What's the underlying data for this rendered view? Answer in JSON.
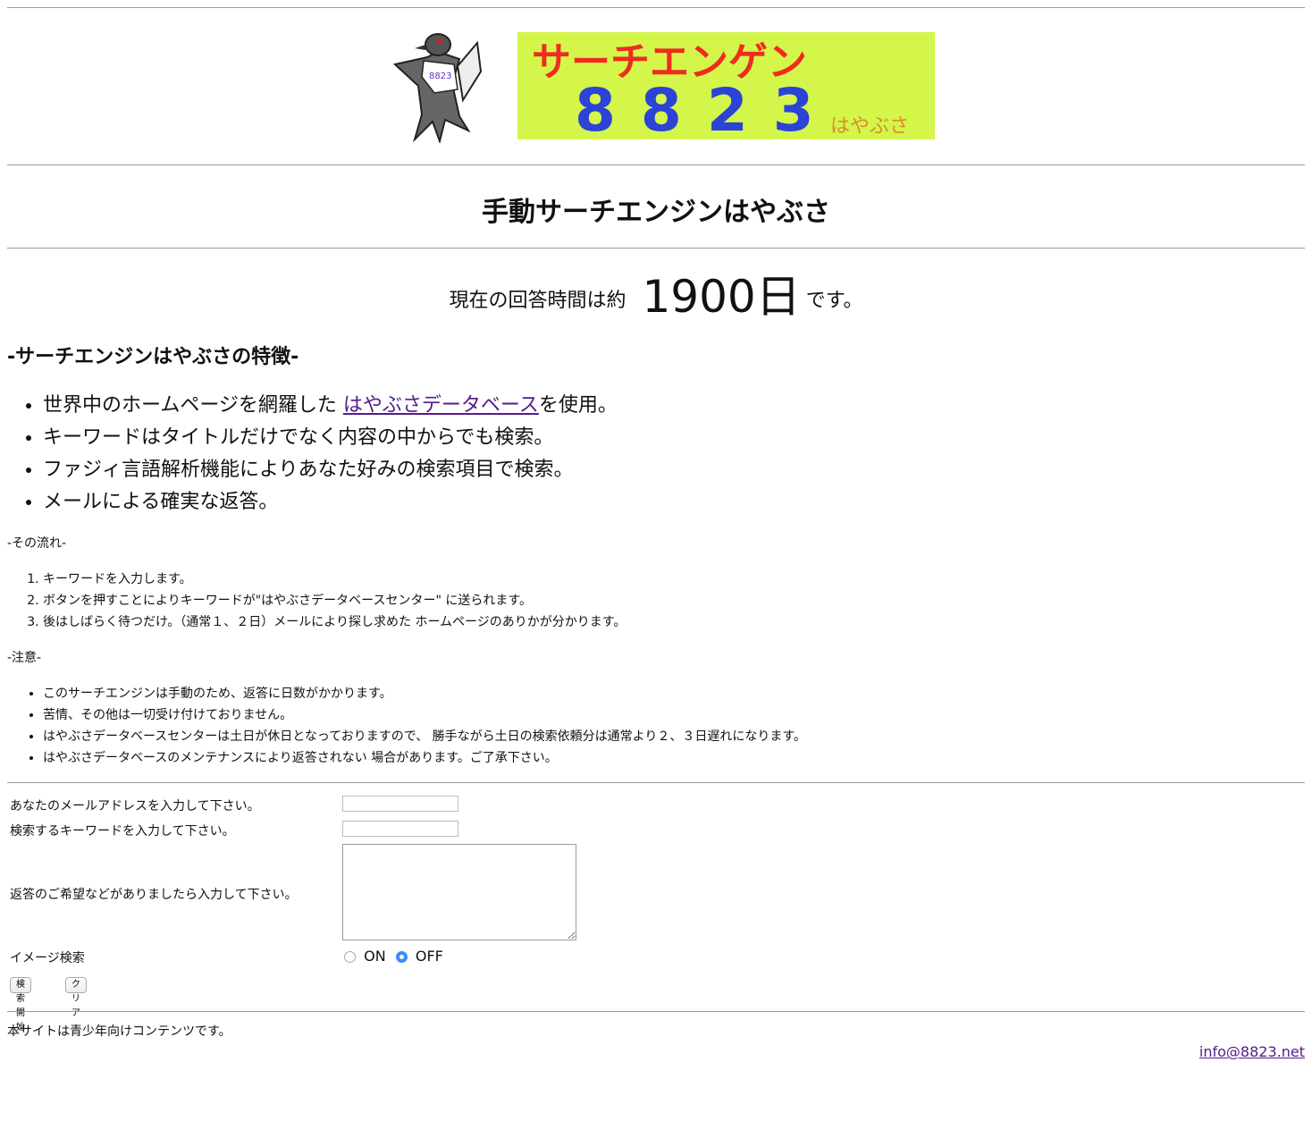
{
  "banner": {
    "title_text": "サーチエンゲン",
    "number_text": "8823",
    "side_text": "はやぶさ",
    "bird_badge": "8823",
    "colors": {
      "background": "#d4f54a",
      "title": "#f02b1f",
      "number": "#2b43d6",
      "side": "#d98e2a"
    }
  },
  "page_title": "手動サーチエンジンはやぶさ",
  "response": {
    "prefix": "現在の回答時間は約",
    "value": "1900日",
    "suffix": "です。"
  },
  "features": {
    "heading": "-サーチエンジンはやぶさの特徴-",
    "item1_before": "世界中のホームページを網羅した ",
    "item1_link": "はやぶさデータベース",
    "item1_after": "を使用。",
    "items": [
      "キーワードはタイトルだけでなく内容の中からでも検索。",
      "ファジィ言語解析機能によりあなた好みの検索項目で検索。",
      "メールによる確実な返答。"
    ]
  },
  "flow": {
    "heading": "-その流れ-",
    "items": [
      "キーワードを入力します。",
      "ボタンを押すことによりキーワードが\"はやぶさデータベースセンター\" に送られます。",
      "後はしばらく待つだけ。（通常１、２日）メールにより探し求めた ホームページのありかが分かります。"
    ]
  },
  "notes": {
    "heading": "-注意-",
    "items": [
      "このサーチエンジンは手動のため、返答に日数がかかります。",
      "苦情、その他は一切受け付けておりません。",
      "はやぶさデータベースセンターは土日が休日となっておりますので、 勝手ながら土日の検索依頼分は通常より２、３日遅れになります。",
      "はやぶさデータベースのメンテナンスにより返答されない 場合があります。ご了承下さい。"
    ]
  },
  "form": {
    "email_label": "あなたのメールアドレスを入力して下さい。",
    "email_value": "",
    "keyword_label": "検索するキーワードを入力して下さい。",
    "keyword_value": "",
    "comment_label": "返答のご希望などがありましたら入力して下さい。",
    "comment_value": "",
    "image_search_label": "イメージ検索",
    "radio_on": "ON",
    "radio_off": "OFF",
    "selected": "OFF",
    "submit_label": "検索開始",
    "clear_label": "クリア"
  },
  "footer": {
    "notice": "本サイトは青少年向けコンテンツです。",
    "email": "info@8823.net"
  }
}
